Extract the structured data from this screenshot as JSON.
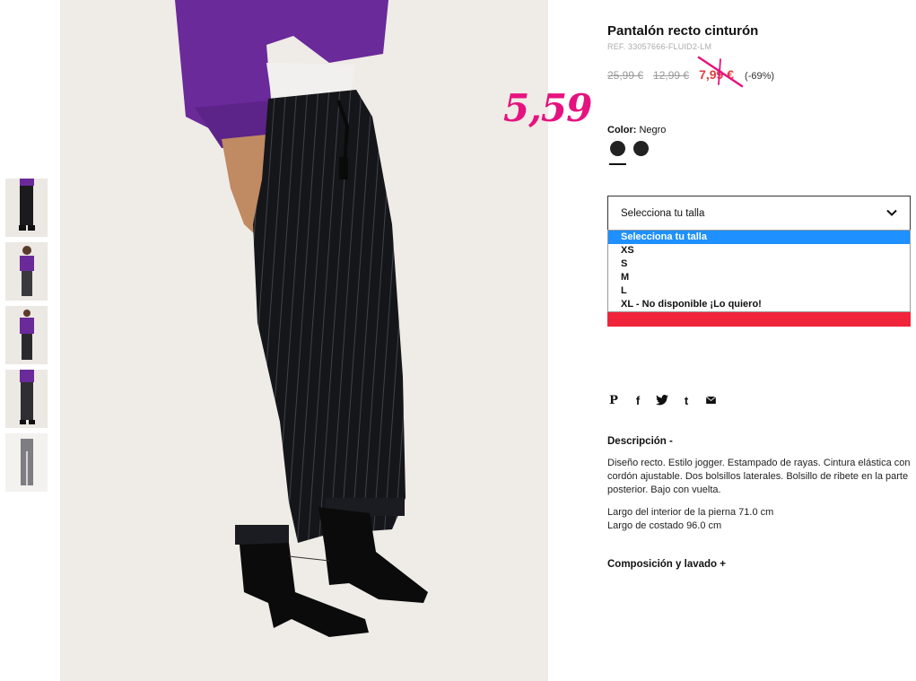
{
  "product": {
    "title": "Pantalón recto cinturón",
    "ref": "REF. 33057666-FLUID2-LM",
    "original_price": "25,99 €",
    "previous_price": "12,99 €",
    "sale_price": "7,99 €",
    "discount": "(-69%)"
  },
  "annotation": {
    "handwritten_price": "5,59",
    "color": "#e5137f"
  },
  "color": {
    "label": "Color:",
    "value": "Negro",
    "swatches": [
      "black",
      "black"
    ]
  },
  "size": {
    "placeholder": "Selecciona tu talla",
    "options": [
      "Selecciona tu talla",
      "XS",
      "S",
      "M",
      "L",
      "XL - No disponible ¡Lo quiero!"
    ],
    "highlighted_index": 0
  },
  "share": {
    "icons": [
      "pinterest-icon",
      "facebook-icon",
      "twitter-icon",
      "tumblr-icon",
      "mail-icon"
    ],
    "pinterest": "P",
    "facebook": "f",
    "twitter": "t",
    "tumblr": "t"
  },
  "description": {
    "title": "Descripción -",
    "text": "Diseño recto. Estilo jogger. Estampado de rayas. Cintura elástica con cordón ajustable. Dos bolsillos laterales. Bolsillo de ribete en la parte posterior. Bajo con vuelta.",
    "inseam": "Largo del interior de la pierna 71.0 cm",
    "side_length": "Largo de costado 96.0 cm"
  },
  "composition": {
    "title": "Composición y lavado +"
  },
  "colors": {
    "accent_red": "#f0243a",
    "sale_red": "#e53a3e",
    "highlight_blue": "#1e90ff"
  }
}
